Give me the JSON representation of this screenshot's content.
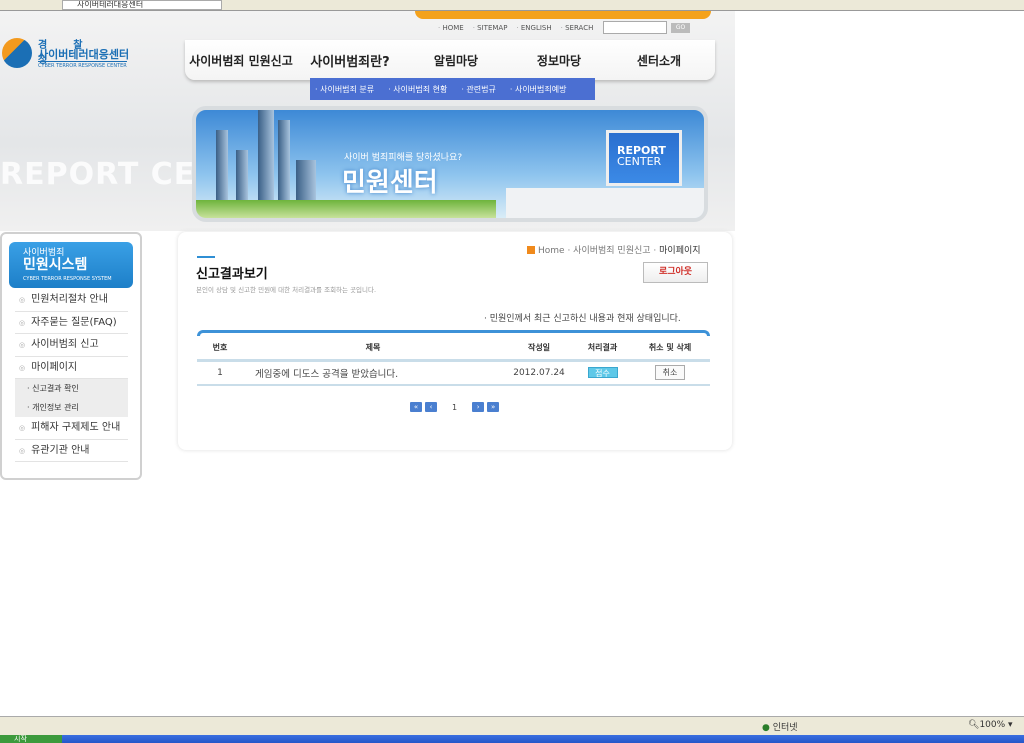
{
  "browser": {
    "tab_title": "사이버테러대응센터",
    "status_zone": "인터넷",
    "zoom": "100%",
    "start": "시작"
  },
  "logo": {
    "line1": "경찰청",
    "line2": "사이버테러대응센터",
    "line3": "CYBER TERROR RESPONSE CENTER"
  },
  "bg_text": "REPORT CENTER",
  "toplinks": [
    "HOME",
    "SITEMAP",
    "ENGLISH",
    "SERACH"
  ],
  "search": {
    "value": "",
    "go": "GO"
  },
  "nav": [
    "사이버범죄 민원신고",
    "사이버범죄란?",
    "알림마당",
    "정보마당",
    "센터소개"
  ],
  "submenu": [
    "사이버범죄 분류",
    "사이버범죄 현황",
    "관련법규",
    "사이버범죄예방"
  ],
  "banner": {
    "question": "사이버 범죄피해를 당하셨나요?",
    "title": "민원센터",
    "monitor1": "REPORT",
    "monitor2": "CENTER"
  },
  "sidebar": {
    "head_small": "사이버범죄",
    "head_big": "민원시스템",
    "head_en": "CYBER TERROR RESPONSE SYSTEM",
    "items": [
      "민원처리절차 안내",
      "자주묻는 질문(FAQ)",
      "사이버범죄 신고",
      "마이페이지",
      "피해자 구제제도 안내",
      "유관기관 안내"
    ],
    "subitems": [
      "신고결과 확인",
      "개인정보 관리"
    ]
  },
  "breadcrumb": [
    "Home",
    "사이버범죄 민원신고",
    "마이페이지"
  ],
  "page": {
    "title": "신고결과보기",
    "subtitle": "본인이 상담 및 신고한 민원에 대한 처리결과를 조회하는 곳입니다.",
    "logout": "로그아웃",
    "note": "· 민원인께서 최근 신고하신 내용과 현재 상태입니다."
  },
  "table": {
    "headers": [
      "번호",
      "제목",
      "작성일",
      "처리결과",
      "취소 및 삭제"
    ],
    "rows": [
      {
        "no": "1",
        "title": "게임중에 디도스 공격을 받았습니다.",
        "date": "2012.07.24",
        "status": "접수",
        "action": "취소"
      }
    ]
  },
  "pager": {
    "first": "«",
    "prev": "‹",
    "current": "1",
    "next": "›",
    "last": "»"
  }
}
